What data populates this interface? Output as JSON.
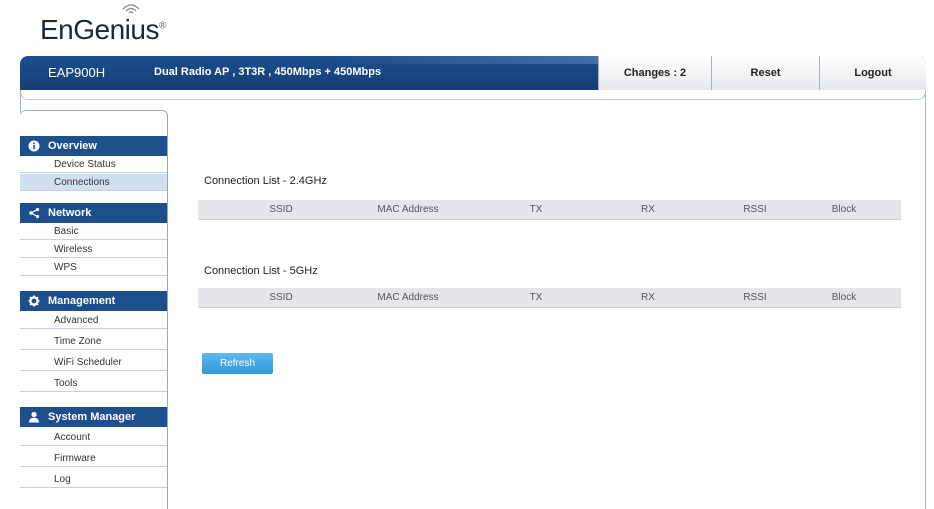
{
  "header": {
    "logo_text": "EnGenius",
    "logo_mark": "®",
    "model": "EAP900H",
    "description": "Dual Radio AP , 3T3R , 450Mbps + 450Mbps",
    "changes_label": "Changes : 2",
    "reset_label": "Reset",
    "logout_label": "Logout"
  },
  "sidebar": {
    "sections": [
      {
        "title": "Overview",
        "icon": "info-icon",
        "items": [
          "Device Status",
          "Connections"
        ]
      },
      {
        "title": "Network",
        "icon": "share-icon",
        "items": [
          "Basic",
          "Wireless",
          "WPS"
        ]
      },
      {
        "title": "Management",
        "icon": "gear-icon",
        "items": [
          "Advanced",
          "Time Zone",
          "WiFi Scheduler",
          "Tools"
        ]
      },
      {
        "title": "System Manager",
        "icon": "user-icon",
        "items": [
          "Account",
          "Firmware",
          "Log"
        ]
      }
    ],
    "active_item": "Connections"
  },
  "main": {
    "list_24": {
      "title": "Connection List - 2.4GHz",
      "columns": [
        "SSID",
        "MAC Address",
        "TX",
        "RX",
        "RSSI",
        "Block"
      ]
    },
    "list_5": {
      "title": "Connection List - 5GHz",
      "columns": [
        "SSID",
        "MAC Address",
        "TX",
        "RX",
        "RSSI",
        "Block"
      ]
    },
    "refresh_label": "Refresh"
  },
  "colors": {
    "header_blue": "#1b4f8f",
    "sidebar_blue": "#1d4f8c",
    "active_item": "#cfe0f5",
    "refresh_blue": "#3aa3e5"
  }
}
